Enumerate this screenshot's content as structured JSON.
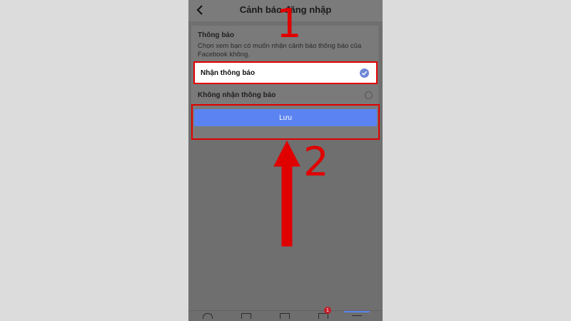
{
  "header": {
    "title": "Cảnh báo đăng nhập"
  },
  "section": {
    "title": "Thông báo",
    "description": "Chọn xem bạn có muốn nhận cảnh báo thông báo của Facebook không."
  },
  "options": [
    {
      "label": "Nhận thông báo",
      "selected": true
    },
    {
      "label": "Không nhận thông báo",
      "selected": false
    }
  ],
  "save_button": {
    "label": "Lưu"
  },
  "bottom_nav": {
    "notification_badge": "1"
  },
  "annotations": {
    "step1": "1",
    "step2": "2"
  },
  "colors": {
    "accent": "#5b84f2",
    "annotation": "#e00000"
  }
}
